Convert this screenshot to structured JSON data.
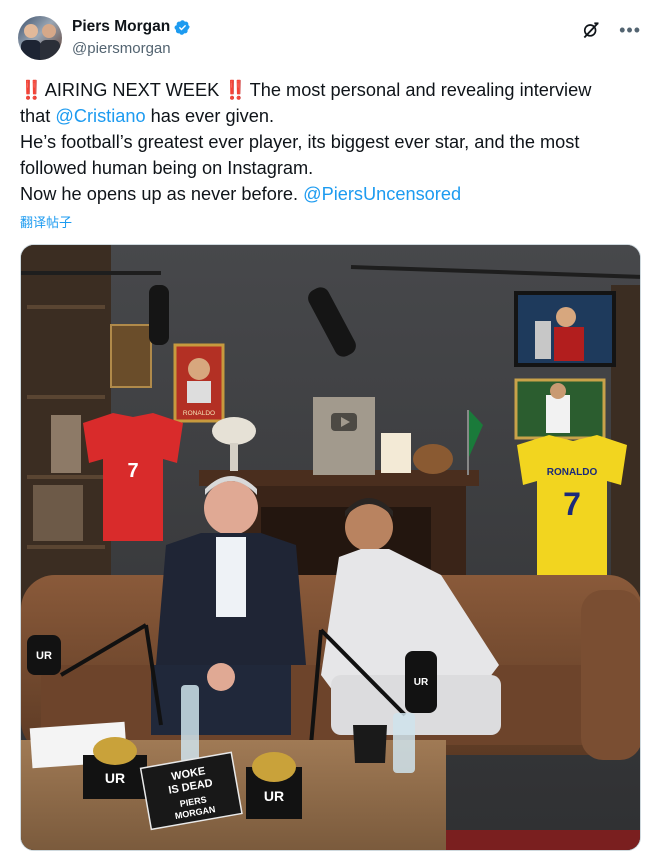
{
  "author": {
    "display_name": "Piers Morgan",
    "handle": "@piersmorgan",
    "verified": true,
    "verified_color": "#1d9bf0"
  },
  "icons": {
    "verified": "verified-badge-icon",
    "grok": "grok-icon",
    "more": "more-options-icon"
  },
  "tweet": {
    "line1_prefix": "‼️",
    "line1_heading": " AIRING NEXT WEEK ",
    "line1_suffix_mark": "‼️",
    "line1_rest": " The most personal and revealing interview",
    "line2_pre": "that ",
    "line2_mention": "@Cristiano",
    "line2_post": " has ever given.",
    "line3": "He’s football’s greatest ever player, its biggest ever star, and the most",
    "line4": "followed human being on Instagram.",
    "line5_pre": "Now he opens up as never before. ",
    "line5_mention": "@PiersUncensored"
  },
  "translate_label": "翻译帖子",
  "media": {
    "jersey_left_number": "7",
    "jersey_right_name": "RONALDO",
    "jersey_right_number": "7",
    "poster_caption": "RONALDO",
    "book_line1": "WOKE",
    "book_line2": "IS DEAD",
    "book_author_line1": "PIERS",
    "book_author_line2": "MORGAN",
    "mic_logo": "UR",
    "box_logo": "UR"
  },
  "colors": {
    "link": "#1d9bf0",
    "text": "#0f1419",
    "secondary": "#536471",
    "alert_red": "#d0021b"
  }
}
